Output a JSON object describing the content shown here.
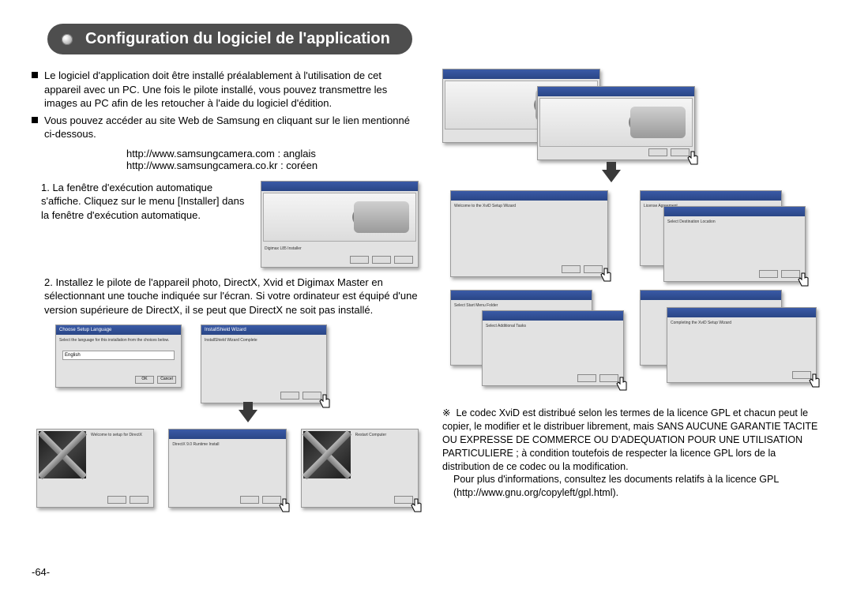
{
  "title": "Configuration du logiciel de l'application",
  "bullets": [
    "Le logiciel d'application doit être installé préalablement à l'utilisation de cet appareil avec un PC. Une fois le pilote installé, vous pouvez transmettre les images au PC afin de les retoucher à l'aide du logiciel d'édition.",
    "Vous pouvez accéder au site Web de Samsung en cliquant sur le lien mentionné ci-dessous."
  ],
  "urls": [
    "http://www.samsungcamera.com : anglais",
    "http://www.samsungcamera.co.kr : coréen"
  ],
  "steps": {
    "s1": "1. La fenêtre d'exécution automatique s'affiche. Cliquez sur le menu [Installer] dans la fenêtre d'exécution automatique.",
    "s2": "2. Installez le pilote de l'appareil photo, DirectX, Xvid et Digimax Master en sélectionnant une touche indiquée sur l'écran. Si votre ordinateur est équipé d'une version supérieure de DirectX, il se peut que DirectX ne soit pas installé."
  },
  "screenshot_labels": {
    "installer": "Digimax L85 Installer",
    "choose_lang_title": "Choose Setup Language",
    "choose_lang_body": "Select the language for this installation from the choices below.",
    "lang_value": "English",
    "ok": "OK",
    "cancel": "Cancel",
    "installshield": "InstallShield Wizard",
    "install_complete": "InstallShield Wizard Complete",
    "welcome_directx": "Welcome to setup for DirectX",
    "directx_install": "DirectX 9.0 Runtime Install",
    "restart": "Restart Computer",
    "xvid_welcome": "Welcome to the XviD Setup Wizard",
    "license": "License Agreement",
    "select_location": "Select Destination Location",
    "select_menu": "Select Start Menu Folder",
    "additional_tasks": "Select Additional Tasks",
    "completing_xvid": "Completing the XviD Setup Wizard"
  },
  "legal": {
    "star": "※",
    "line1": "Le codec XviD est distribué selon les termes de la licence GPL et chacun peut le copier, le modifier et le distribuer librement, mais SANS AUCUNE GARANTIE TACITE OU EXPRESSE DE COMMERCE OU D'ADEQUATION POUR UNE UTILISATION PARTICULIERE ; à condition toutefois de respecter la licence GPL lors de la distribution de ce codec ou la modification.",
    "line2": "Pour plus d'informations, consultez les documents relatifs à la licence GPL (http://www.gnu.org/copyleft/gpl.html)."
  },
  "page_number": "-64-"
}
